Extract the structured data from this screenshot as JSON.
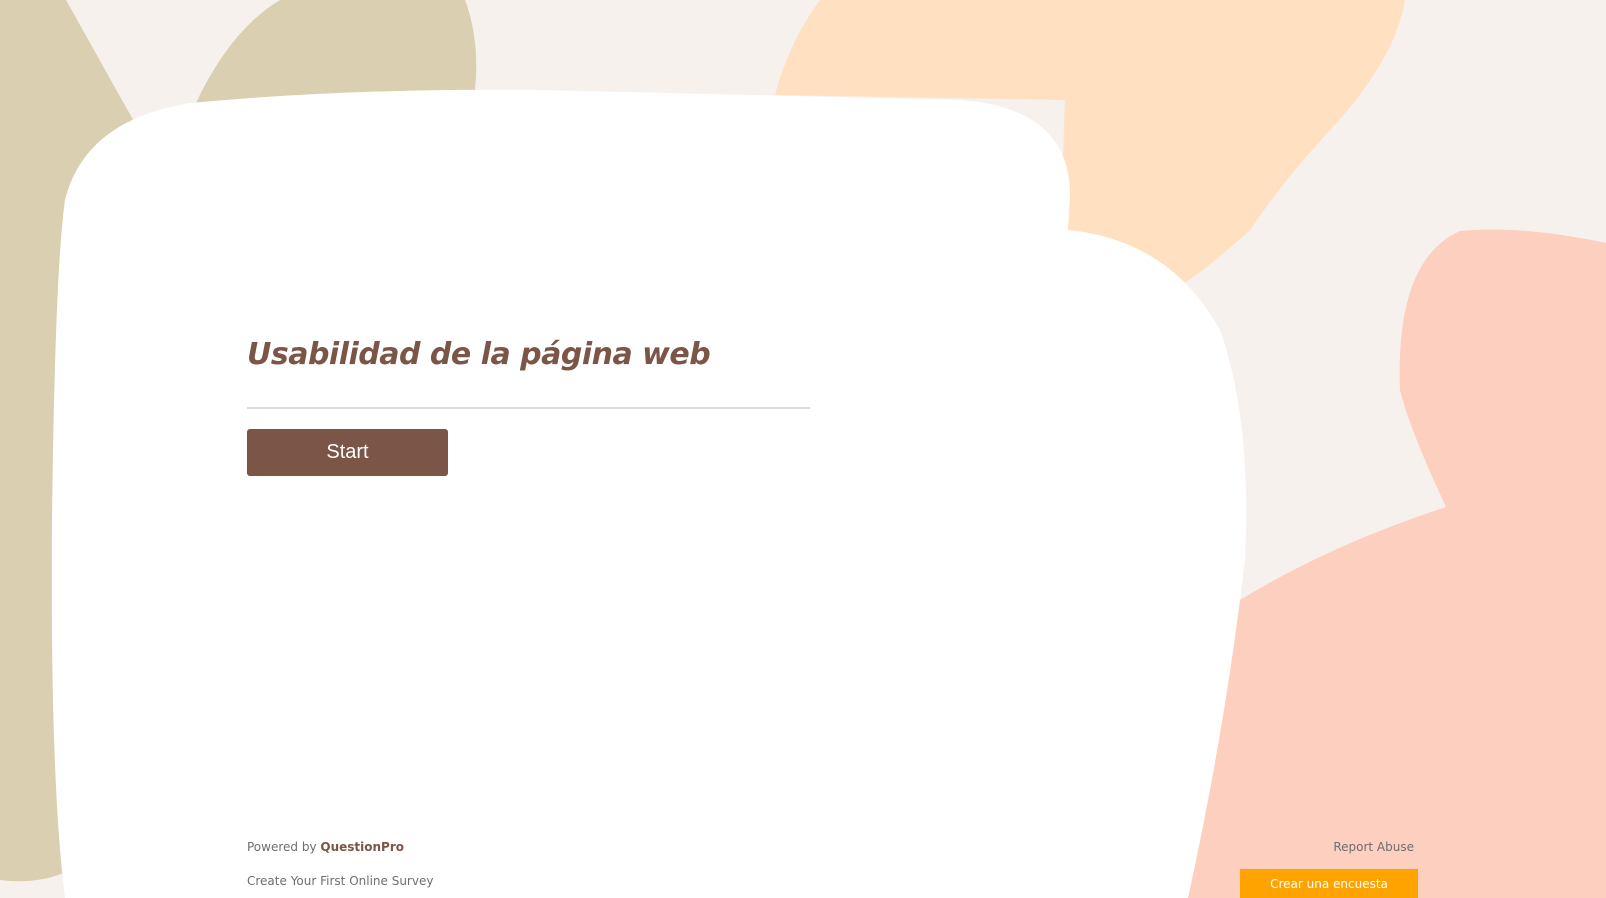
{
  "colors": {
    "background": "#f6f1ec",
    "accent": "#7b5546",
    "blob_olive": "#dacfb1",
    "blob_peach": "#ffe0c0",
    "blob_salmon": "#fdcfbe",
    "cta_orange": "#ffa300"
  },
  "survey": {
    "title": "Usabilidad de la página web",
    "start_label": "Start"
  },
  "footer": {
    "powered_by": "Powered by",
    "brand": "QuestionPro",
    "create_first_survey": "Create Your First Online Survey",
    "report_abuse": "Report Abuse",
    "create_survey_button": "Crear una encuesta"
  }
}
